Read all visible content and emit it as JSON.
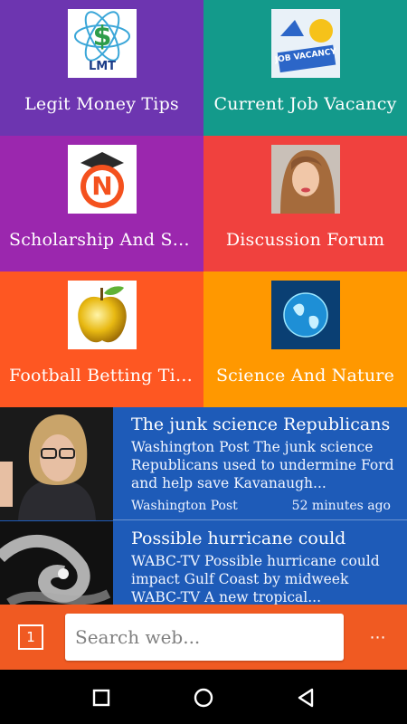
{
  "tiles": [
    {
      "label": "Legit Money Tips",
      "bg": "#6d35b0",
      "icon": "lmt-dollar-logo-icon",
      "logo_text": "LMT"
    },
    {
      "label": "Current  Job Vacancy",
      "bg": "#139a8b",
      "icon": "job-vacancy-icon",
      "logo_text": "JOB VACANCY"
    },
    {
      "label": "Scholarship And Sch...",
      "bg": "#9b27ae",
      "icon": "scholarship-n-logo-icon",
      "logo_text": "N"
    },
    {
      "label": "Discussion Forum",
      "bg": "#f0413e",
      "icon": "woman-portrait-icon"
    },
    {
      "label": "Football Betting Tips",
      "bg": "#fe5722",
      "icon": "golden-apple-icon"
    },
    {
      "label": "Science And Nature",
      "bg": "#ff9800",
      "icon": "globe-icon"
    }
  ],
  "news": [
    {
      "title": "The junk science Republicans",
      "description": "Washington Post The junk science Republicans used to undermine Ford and help save Kavanaugh...",
      "source": "Washington Post",
      "time": "52 minutes ago",
      "image": "person-photo-icon"
    },
    {
      "title": "Possible hurricane could",
      "description": "WABC-TV Possible hurricane could impact Gulf Coast by midweek WABC-TV A new tropical...",
      "source": "",
      "time": "",
      "image": "satellite-storm-icon"
    }
  ],
  "bottom": {
    "tab_count": "1",
    "search_placeholder": "Search web...",
    "more_label": "⋯"
  },
  "colors": {
    "news_bg": "#1e5bb8",
    "bottom_bar": "#f05a22"
  }
}
